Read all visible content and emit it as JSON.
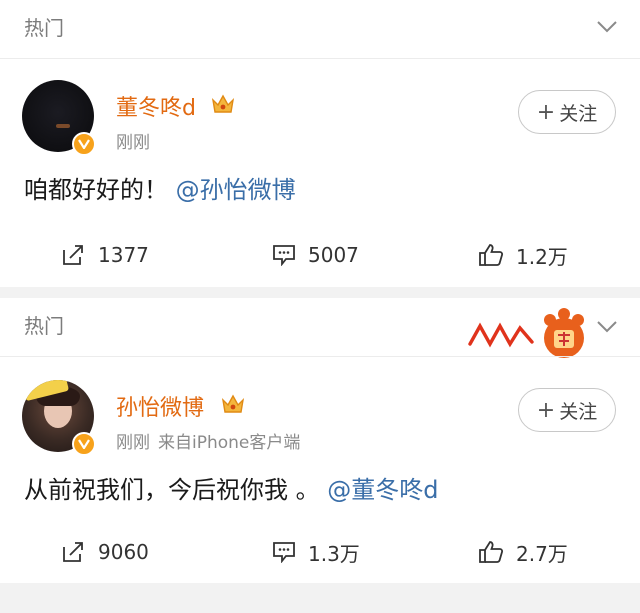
{
  "posts": [
    {
      "section_label": "热门",
      "username": "董冬咚d",
      "meta": [
        "刚刚"
      ],
      "follow_label": "关注",
      "text": "咱都好好的！",
      "mention": "@孙怡微博",
      "actions": {
        "repost": "1377",
        "comment": "5007",
        "like": "1.2万"
      }
    },
    {
      "section_label": "热门",
      "username": "孙怡微博",
      "meta": [
        "刚刚",
        "来自iPhone客户端"
      ],
      "follow_label": "关注",
      "text": "从前祝我们，今后祝你我 。",
      "mention": "@董冬咚d",
      "actions": {
        "repost": "9060",
        "comment": "1.3万",
        "like": "2.7万"
      }
    }
  ],
  "colors": {
    "username": "#e26a12",
    "mention": "#3a6ea8",
    "verified_badge": "#f7a21b",
    "background": "#f2f2f2"
  },
  "icons": [
    "chevron-down-icon",
    "crown-icon",
    "verified-icon",
    "plus-icon",
    "repost-icon",
    "comment-icon",
    "like-icon"
  ]
}
